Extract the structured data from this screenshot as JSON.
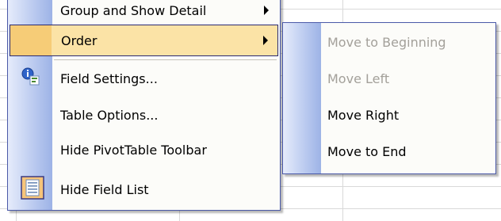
{
  "main_menu": {
    "items": [
      {
        "label": "Group and Show Detail",
        "has_submenu": true,
        "state": "normal"
      },
      {
        "label": "Order",
        "has_submenu": true,
        "state": "highlighted"
      },
      {
        "label": "Field Settings...",
        "icon": "field-settings-icon",
        "state": "normal"
      },
      {
        "label": "Table Options...",
        "state": "normal"
      },
      {
        "label": "Hide PivotTable Toolbar",
        "state": "normal"
      },
      {
        "label": "Hide Field List",
        "icon": "field-list-icon",
        "state": "normal"
      }
    ]
  },
  "submenu": {
    "items": [
      {
        "label": "Move to Beginning",
        "state": "disabled"
      },
      {
        "label": "Move Left",
        "state": "disabled"
      },
      {
        "label": "Move Right",
        "state": "enabled"
      },
      {
        "label": "Move to End",
        "state": "enabled"
      }
    ]
  },
  "colors": {
    "highlight_bg": "#fbe3a6",
    "menu_border": "#4a59a8",
    "disabled_text": "#a3a09a"
  }
}
